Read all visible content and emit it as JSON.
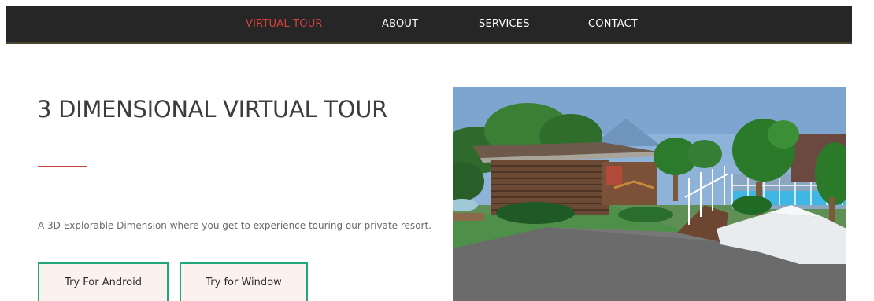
{
  "nav": {
    "items": [
      {
        "label": "VIRTUAL TOUR",
        "active": true
      },
      {
        "label": "ABOUT",
        "active": false
      },
      {
        "label": "SERVICES",
        "active": false
      },
      {
        "label": "CONTACT",
        "active": false
      }
    ]
  },
  "hero": {
    "title": "3 DIMENSIONAL VIRTUAL TOUR",
    "description": "A 3D Explorable Dimension where you get to experience touring our private resort.",
    "buttons": {
      "android_label": "Try For Android",
      "window_label": "Try for Window"
    }
  },
  "colors": {
    "nav_bg": "#262626",
    "nav_active": "#d9413b",
    "accent_underline": "#c8413a",
    "button_border": "#21a676",
    "button_bg": "#fbf1ee"
  }
}
